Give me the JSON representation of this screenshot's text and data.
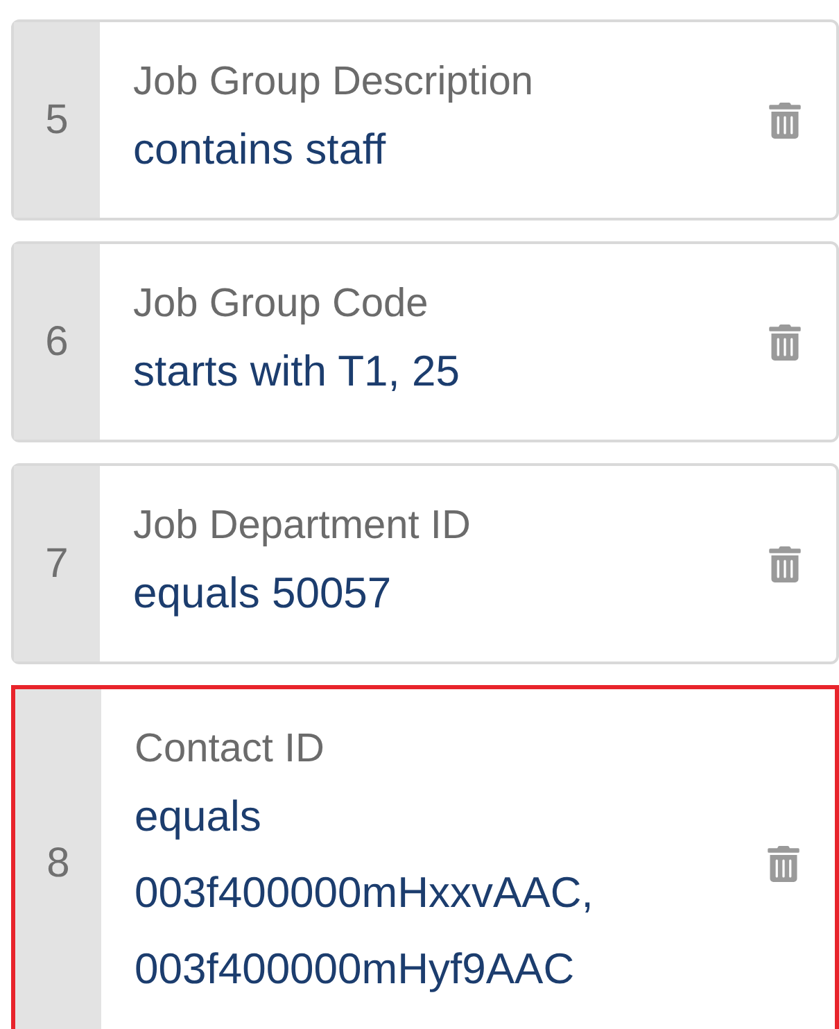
{
  "filters": [
    {
      "number": "5",
      "field": "Job Group Description",
      "condition": "contains staff",
      "selected": false
    },
    {
      "number": "6",
      "field": "Job Group Code",
      "condition": "starts with T1, 25",
      "selected": false
    },
    {
      "number": "7",
      "field": "Job Department ID",
      "condition": "equals 50057",
      "selected": false
    },
    {
      "number": "8",
      "field": "Contact ID",
      "condition": "equals 003f400000mHxxvAAC, 003f400000mHyf9AAC",
      "selected": true
    }
  ]
}
